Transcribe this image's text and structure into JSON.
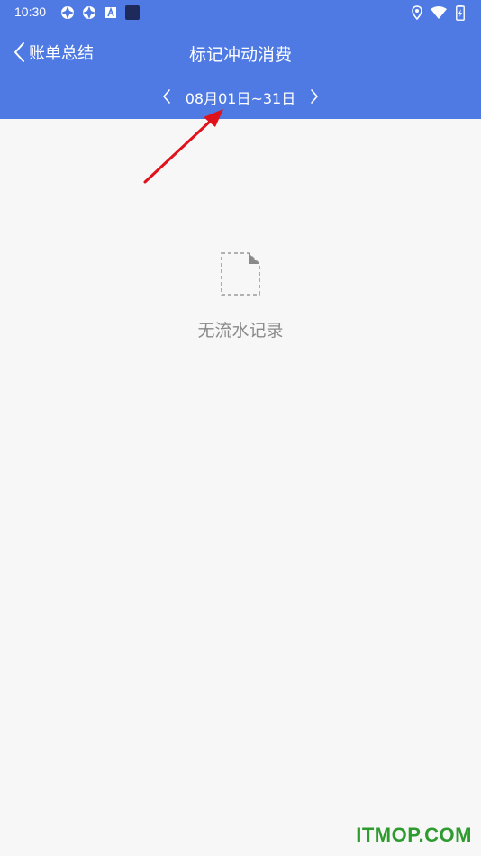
{
  "status_bar": {
    "time": "10:30",
    "left_icons": [
      "notification-icon",
      "notification-icon",
      "app-a-icon",
      "square-icon"
    ],
    "right_icons": [
      "location-icon",
      "wifi-icon",
      "battery-icon"
    ]
  },
  "header": {
    "back_label": "账单总结",
    "title": "标记冲动消费",
    "date_range": "08月01日~31日",
    "bg_color": "#4f7ae3"
  },
  "content": {
    "empty_text": "无流水记录",
    "empty_icon": "empty-document-icon"
  },
  "annotation": {
    "arrow_color": "#e0121b"
  },
  "watermark": "ITMOP.COM"
}
